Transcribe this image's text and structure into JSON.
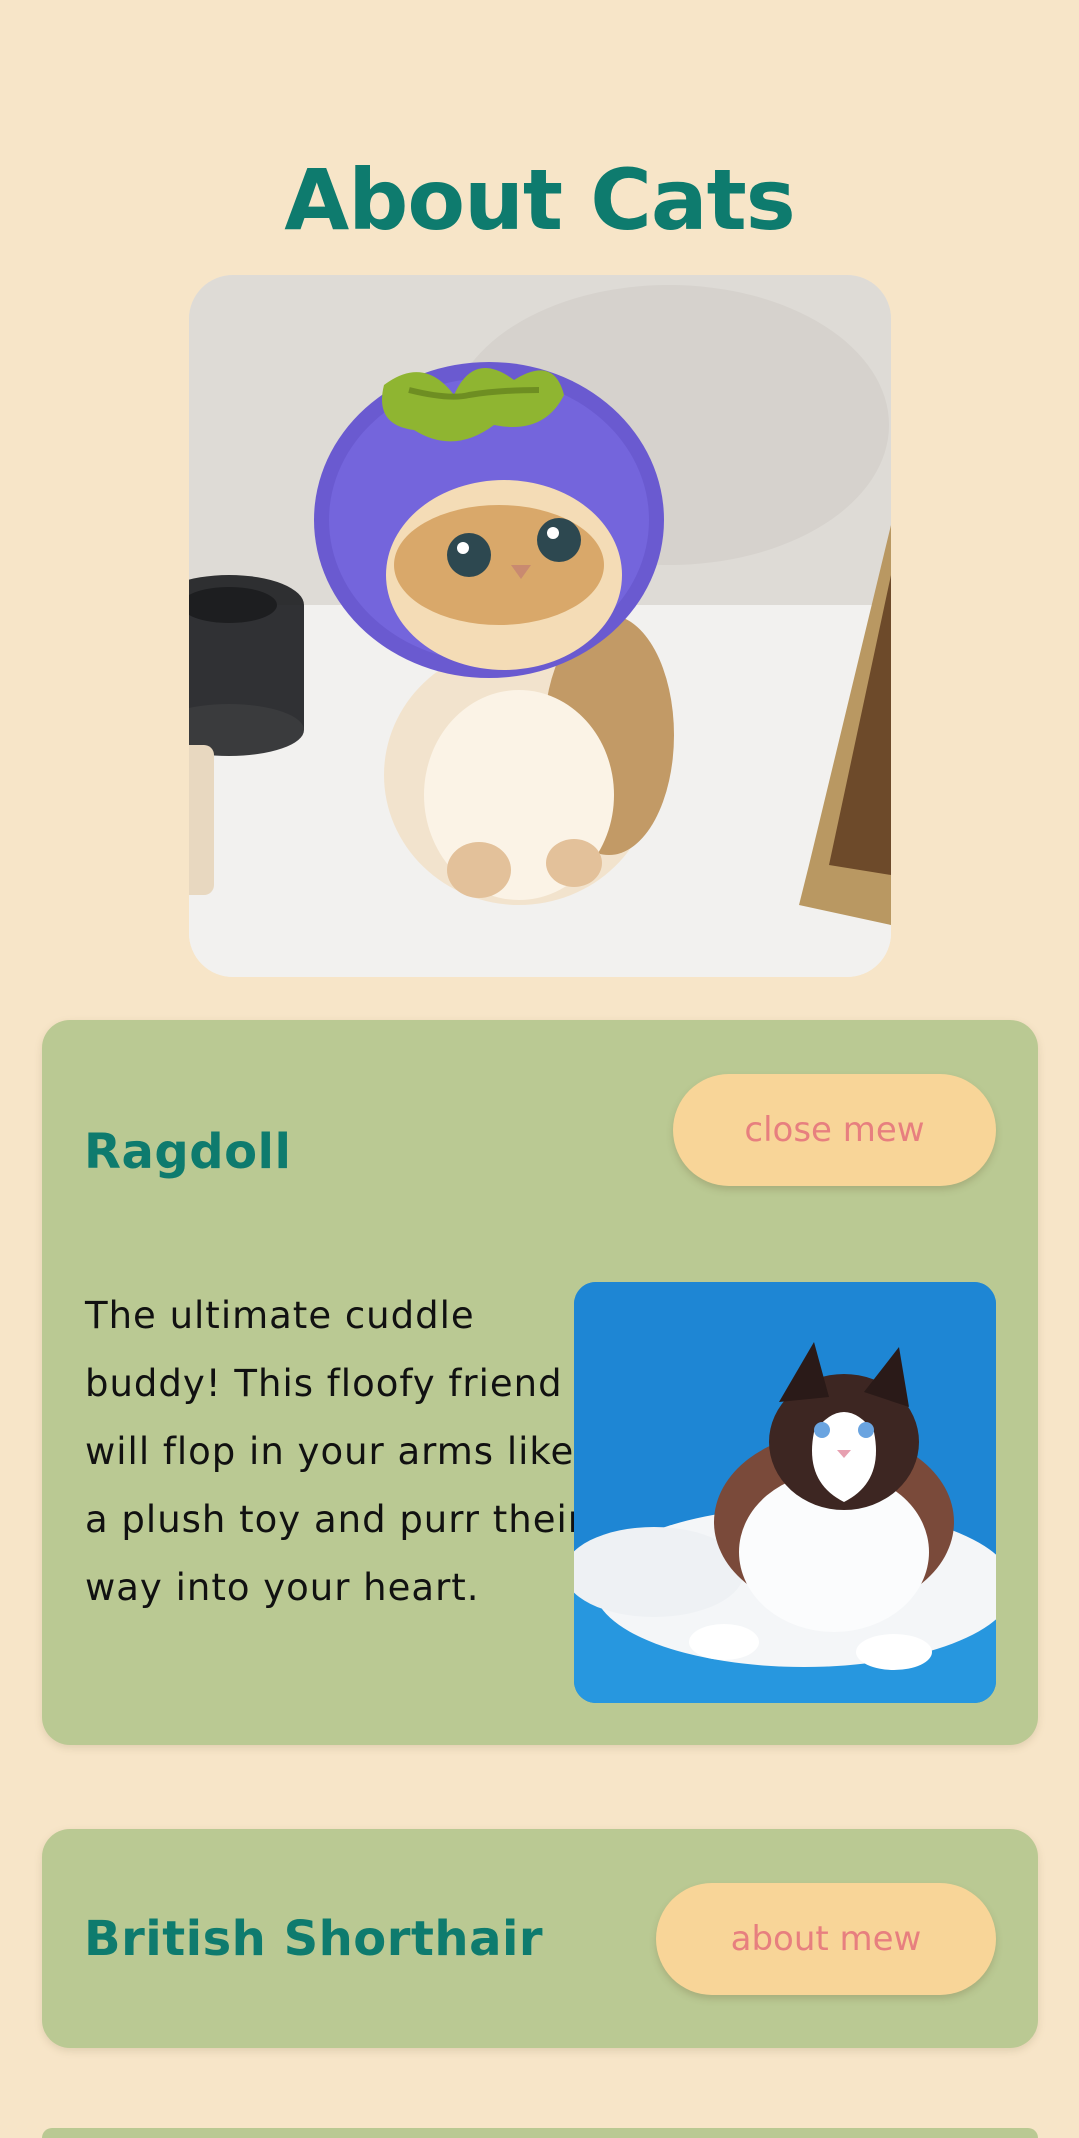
{
  "page": {
    "title": "About Cats",
    "background": "#f7e5c8",
    "accent": "#0e7b6e"
  },
  "hero": {
    "subject": "cat wearing purple fruit hat",
    "icon": "cat-photo"
  },
  "cards": [
    {
      "title": "Ragdoll",
      "button_label": "close mew",
      "expanded": true,
      "description": "The ultimate cuddle buddy! This floofy friend will flop in your arms like a plush toy and purr their way into your heart.",
      "image_subject": "ragdoll cat on blue background"
    },
    {
      "title": "British Shorthair",
      "button_label": "about mew",
      "expanded": false
    }
  ],
  "colors": {
    "card": "#bac993",
    "button": "#f8d598",
    "button_text": "#e77f7f"
  }
}
